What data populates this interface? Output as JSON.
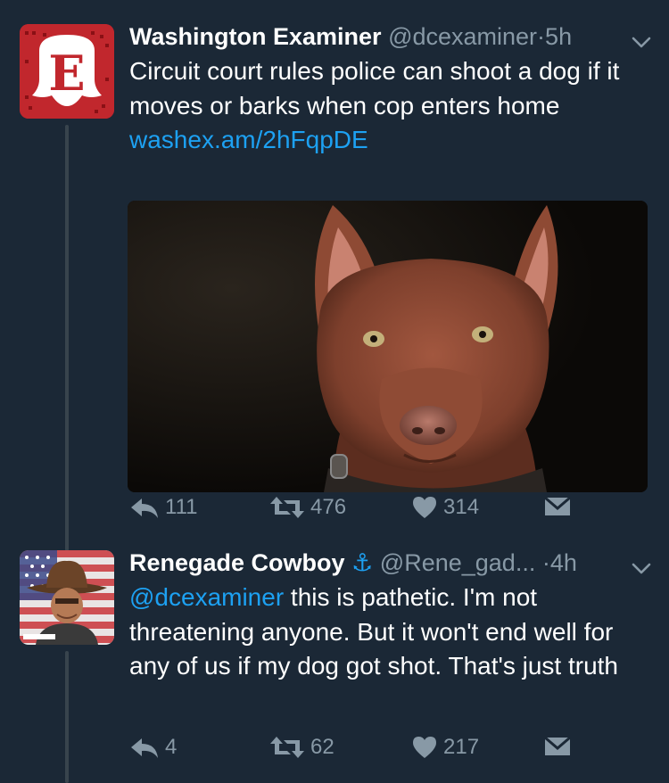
{
  "colors": {
    "background": "#1b2836",
    "link": "#1da1f2",
    "muted": "#8899a6",
    "text": "#ffffff"
  },
  "tweets": [
    {
      "name": "Washington Examiner",
      "handle": "@dcexaminer",
      "separator": "·",
      "time": "5h",
      "text": "Circuit court rules police can shoot a dog if it moves or barks when cop enters home ",
      "link": "washex.am/2hFqpDE",
      "avatar_icon": "washington-examiner-logo",
      "has_media": true,
      "media_icon": "dog-photo",
      "replies": "111",
      "retweets": "476",
      "likes": "314"
    },
    {
      "name": "Renegade Cowboy",
      "name_emoji": "⚓",
      "handle": "@Rene_gad...",
      "separator": "·",
      "time": "4h",
      "mention": "@dcexaminer",
      "text": " this is pathetic. I'm not threatening anyone. But it won't end well for any of us if my dog got shot. That's just truth",
      "avatar_icon": "cowboy-avatar",
      "replies": "4",
      "retweets": "62",
      "likes": "217"
    }
  ]
}
